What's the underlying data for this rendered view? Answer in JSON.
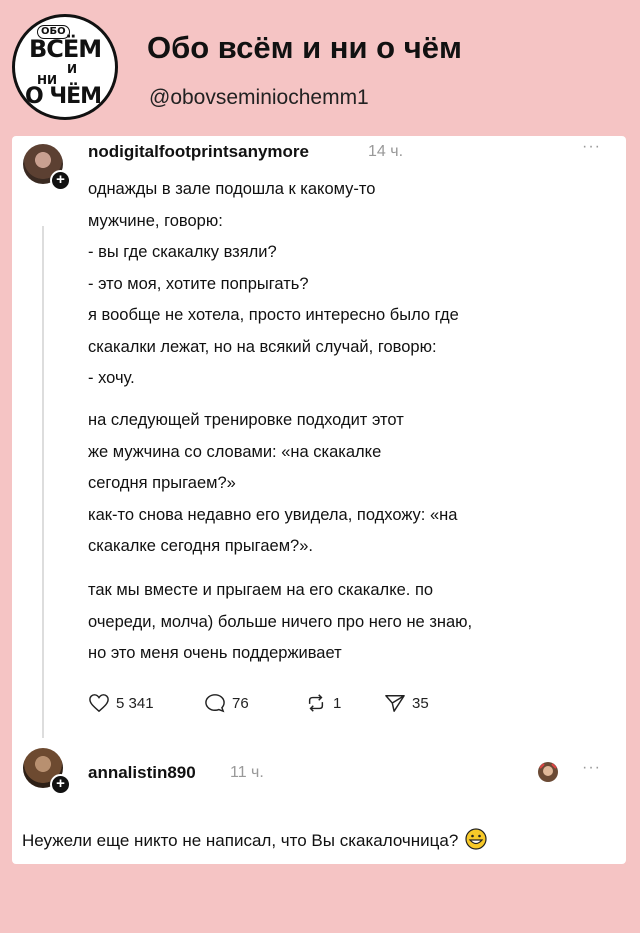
{
  "channel": {
    "logo_lines": [
      "ОБО",
      "ВСЁМ",
      "И",
      "НИ",
      "О ЧЁМ"
    ],
    "title": "Обо всём и ни о чём",
    "handle": "@obovseminiochemm1"
  },
  "post": {
    "username": "nodigitalfootprintsanymore",
    "time": "14 ч.",
    "more_icon": "ellipsis-icon",
    "paragraphs": [
      "однажды в зале подошла к какому-то\nмужчине, говорю:\n- вы где скакалку взяли?\n- это моя, хотите попрыгать?\nя вообще не хотела, просто интересно было где\nскакалки лежат, но на всякий случай, говорю:\n- хочу.",
      "на следующей тренировке подходит этот\nже мужчина со словами: «на скакалке\nсегодня прыгаем?»\nкак-то снова недавно его увидела, подхожу: «на\nскакалке сегодня прыгаем?».",
      "так мы вместе и прыгаем на его скакалке. по\nочереди, молча) больше ничего про него не знаю,\nно это меня очень поддерживает"
    ],
    "stats": {
      "likes": "5 341",
      "comments": "76",
      "reposts": "1",
      "shares": "35"
    }
  },
  "reply": {
    "username": "annalistin890",
    "time": "11 ч.",
    "text": "Неужели еще никто не написал, что Вы скакалочница?"
  }
}
